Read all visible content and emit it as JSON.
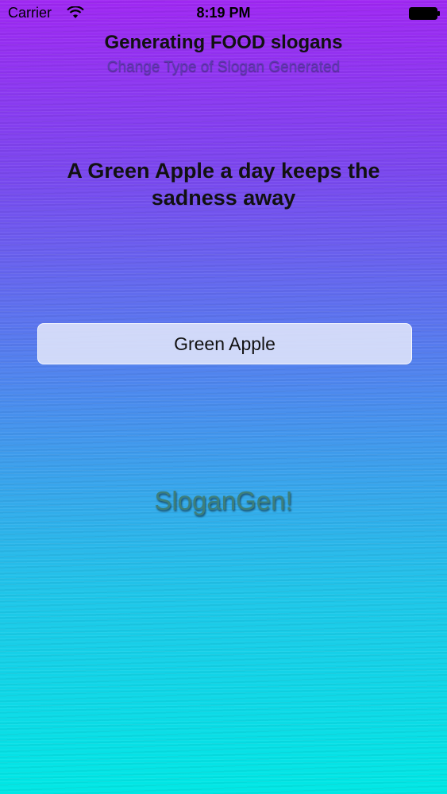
{
  "status_bar": {
    "carrier": "Carrier",
    "time": "8:19 PM",
    "wifi_icon": "wifi-icon",
    "battery_icon": "battery-full-icon"
  },
  "header": {
    "title": "Generating FOOD slogans",
    "change_type_label": "Change Type of Slogan Generated"
  },
  "slogan": {
    "text": "A Green Apple a day keeps the sadness away"
  },
  "food_input": {
    "value": "Green Apple"
  },
  "generate_button": {
    "label": "SloganGen!"
  },
  "colors": {
    "gradient_top": "#9f28f2",
    "gradient_middle": "#4f86ee",
    "gradient_bottom": "#00e8e5",
    "button_text": "#3e7f7a",
    "subtitle_text": "#5d3bb0"
  }
}
